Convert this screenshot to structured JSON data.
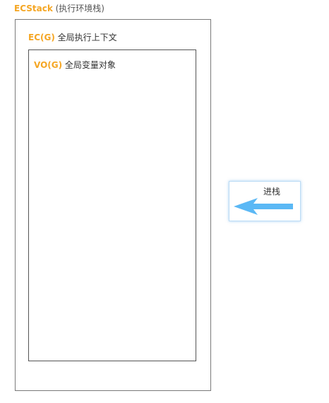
{
  "ecstack": {
    "name": "ECStack",
    "desc": " (执行环境栈)"
  },
  "global_context": {
    "name": "EC(G)",
    "desc": " 全局执行上下文"
  },
  "variable_object": {
    "name": "VO(G)",
    "desc": " 全局变量对象"
  },
  "push_action": {
    "label": "进栈",
    "direction_icon": "left-arrow-icon",
    "arrow_color": "#5bb8f5"
  },
  "colors": {
    "accent": "#f5a623",
    "text": "#333333",
    "border": "#7a7a7a"
  }
}
